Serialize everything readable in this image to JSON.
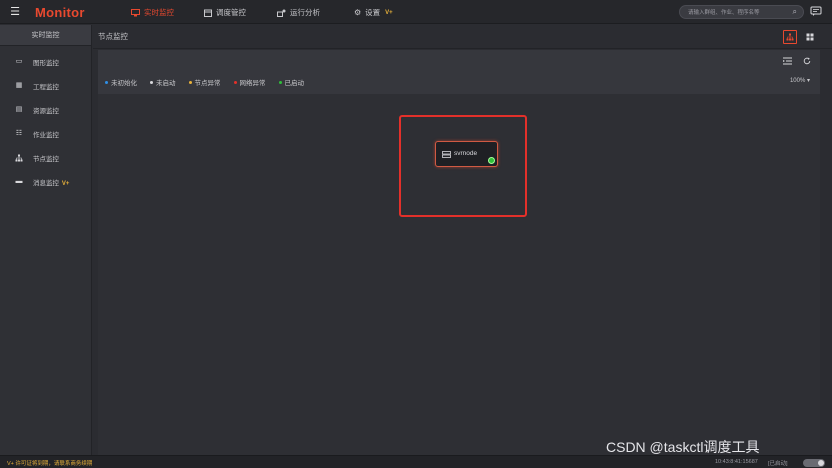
{
  "header": {
    "brand": "Monitor",
    "nav": [
      {
        "label": "实时监控",
        "icon": "monitor-cluster-icon",
        "active": true
      },
      {
        "label": "调度管控",
        "icon": "calendar-icon",
        "active": false
      },
      {
        "label": "运行分析",
        "icon": "analysis-icon",
        "active": false
      },
      {
        "label": "设置",
        "icon": "gear-icon",
        "active": false,
        "badge": "V+"
      }
    ],
    "search_placeholder": "请输入群组、作业、程序名等"
  },
  "sidebar": {
    "title": "实时监控",
    "items": [
      {
        "label": "图形监控",
        "icon": "screen-icon"
      },
      {
        "label": "工程监控",
        "icon": "project-icon"
      },
      {
        "label": "资源监控",
        "icon": "resource-icon"
      },
      {
        "label": "作业监控",
        "icon": "job-list-icon"
      },
      {
        "label": "节点监控",
        "icon": "node-tree-icon"
      },
      {
        "label": "消息监控",
        "icon": "message-icon",
        "badge": "V+"
      }
    ]
  },
  "main": {
    "title": "节点监控",
    "legend": [
      {
        "label": "未初始化",
        "color": "#2f8fe6"
      },
      {
        "label": "未启动",
        "color": "#d8d8dc"
      },
      {
        "label": "节点异常",
        "color": "#e9b23a"
      },
      {
        "label": "网络异常",
        "color": "#e3302a"
      },
      {
        "label": "已启动",
        "color": "#2fbf3a"
      }
    ],
    "zoom": "100%",
    "node": {
      "label": "svrnode",
      "status_color": "#2fbf3a"
    }
  },
  "footer": {
    "warning": "V+ 许可证将到期，请联系商务续期",
    "time": "10:43:8:41:15687",
    "state": "[已启动]"
  },
  "watermark": "CSDN @taskctl调度工具",
  "colors": {
    "accent": "#e8492f",
    "highlight": "#e3302a"
  }
}
